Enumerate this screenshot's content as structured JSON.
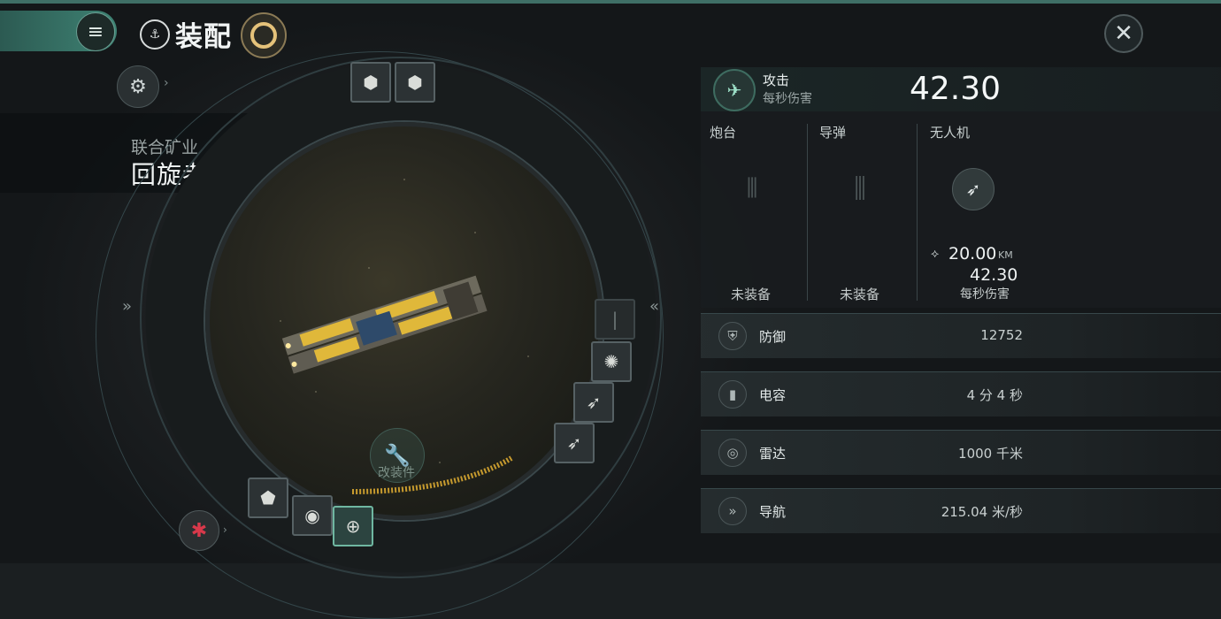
{
  "header": {
    "menu_icon": "≡",
    "title": "装配",
    "close_icon": "✕"
  },
  "ship": {
    "corporation": "联合矿业",
    "name": "回旋者级",
    "warning_icon": "!"
  },
  "center": {
    "mod_label": "改装件",
    "arrow_left": "»",
    "arrow_right": "«"
  },
  "attack": {
    "label": "攻击",
    "sublabel": "每秒伤害",
    "value": "42.30"
  },
  "weapons": {
    "turret": {
      "label": "炮台",
      "status": "未装备"
    },
    "missile": {
      "label": "导弹",
      "status": "未装备"
    },
    "drone": {
      "label": "无人机",
      "range": "20.00",
      "range_unit": "KM",
      "dps": "42.30",
      "dps_label": "每秒伤害"
    }
  },
  "stats": [
    {
      "label": "防御",
      "value": "12752",
      "icon": "shield-icon"
    },
    {
      "label": "电容",
      "value": "4 分 4 秒",
      "icon": "capacitor-icon"
    },
    {
      "label": "雷达",
      "value": "1000 千米",
      "icon": "radar-icon"
    },
    {
      "label": "导航",
      "value": "215.04 米/秒",
      "icon": "navigation-icon"
    }
  ],
  "colors": {
    "accent": "#3e8273",
    "ship_yellow": "#e0b83a"
  }
}
